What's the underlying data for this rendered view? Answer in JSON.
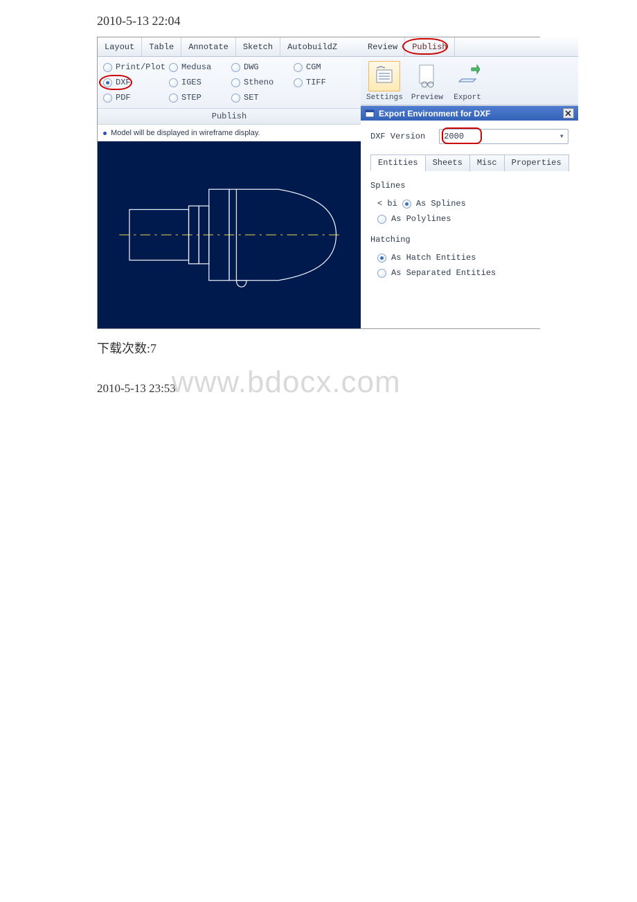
{
  "timestamps": {
    "top": "2010-5-13 22:04",
    "bottom": "2010-5-13 23:53"
  },
  "menu": {
    "layout": "Layout",
    "table": "Table",
    "annotate": "Annotate",
    "sketch": "Sketch",
    "autobuildz": "AutobuildZ",
    "review": "Review",
    "publish": "Publish"
  },
  "formats": {
    "print_plot": "Print/Plot",
    "medusa": "Medusa",
    "dwg": "DWG",
    "cgm": "CGM",
    "dxf": "DXF",
    "iges": "IGES",
    "stheno": "Stheno",
    "tiff": "TIFF",
    "pdf": "PDF",
    "step": "STEP",
    "set": "SET",
    "section_label": "Publish"
  },
  "status": "Model will be displayed in wireframe display.",
  "right_toolbar": {
    "settings": "Settings",
    "preview": "Preview",
    "export": "Export"
  },
  "export_env": {
    "title": "Export Environment for DXF",
    "version_label": "DXF Version",
    "version_value": "2000",
    "tabs": {
      "entities": "Entities",
      "sheets": "Sheets",
      "misc": "Misc",
      "properties": "Properties"
    },
    "splines": {
      "title": "Splines",
      "as_splines": "As Splines",
      "as_polylines": "As Polylines"
    },
    "hatching": {
      "title": "Hatching",
      "as_hatch": "As Hatch Entities",
      "as_separated": "As Separated Entities"
    }
  },
  "downloads": {
    "label": "下载次数:7"
  },
  "watermark": "www.bdocx.com"
}
